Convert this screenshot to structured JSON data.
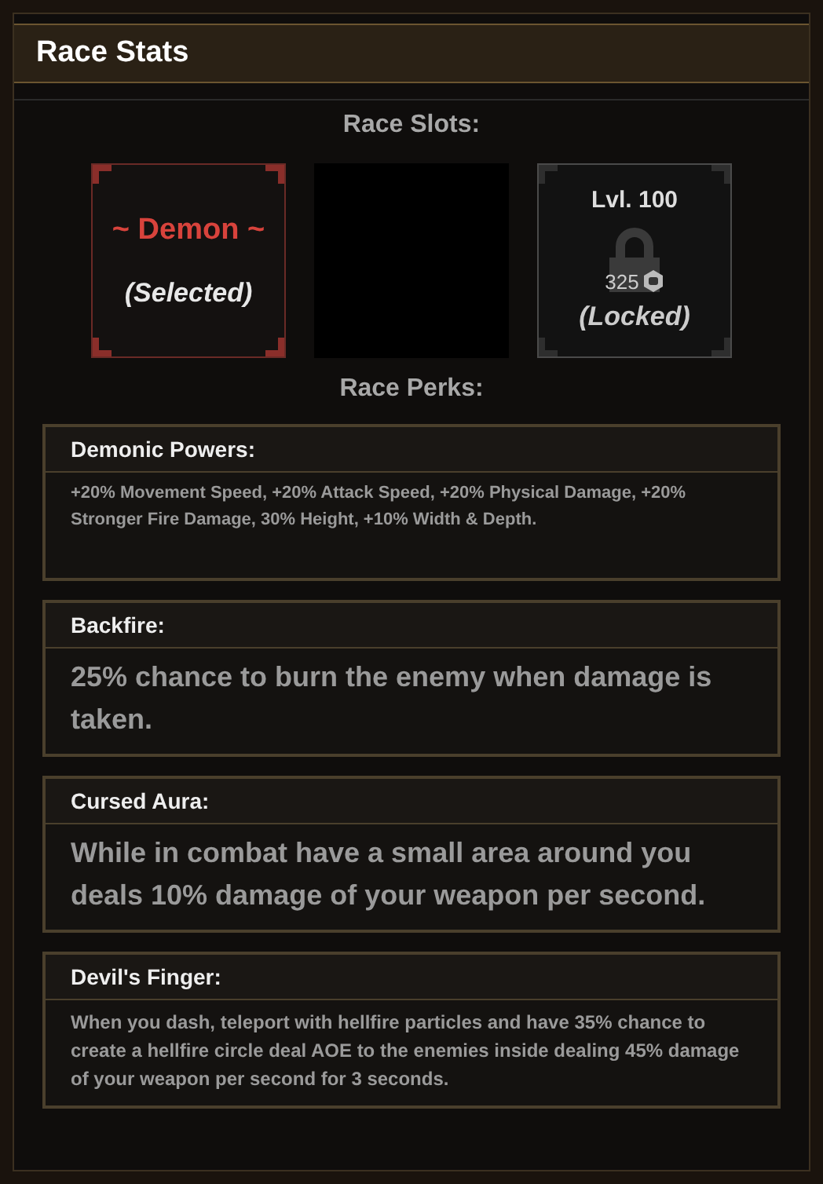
{
  "panel": {
    "title": "Race Stats"
  },
  "slots_heading": "Race Slots:",
  "slots": [
    {
      "kind": "race",
      "name": "~ Demon ~",
      "status": "(Selected)",
      "selected": true
    },
    {
      "kind": "empty",
      "selected": false
    },
    {
      "kind": "locked",
      "level": "Lvl. 100",
      "cost": "325",
      "status": "(Locked)",
      "selected": false
    }
  ],
  "perks_heading": "Race Perks:",
  "perks": [
    {
      "title": "Demonic Powers:",
      "description": "+20% Movement Speed, +20% Attack Speed, +20% Physical Damage, +20% Stronger Fire Damage, 30% Height, +10% Width & Depth.",
      "kind": "small"
    },
    {
      "title": "Backfire:",
      "description": "25% chance to burn the enemy when damage is taken.",
      "kind": "large"
    },
    {
      "title": "Cursed Aura:",
      "description": "While in combat have a small area around you deals 10% damage of your weapon per second.",
      "kind": "large"
    },
    {
      "title": "Devil's Finger:",
      "description": "When you dash, teleport with hellfire particles and have 35% chance to create a hellfire circle deal AOE to the enemies inside dealing 45% damage of your weapon per second for 3 seconds.",
      "kind": "medium"
    }
  ]
}
